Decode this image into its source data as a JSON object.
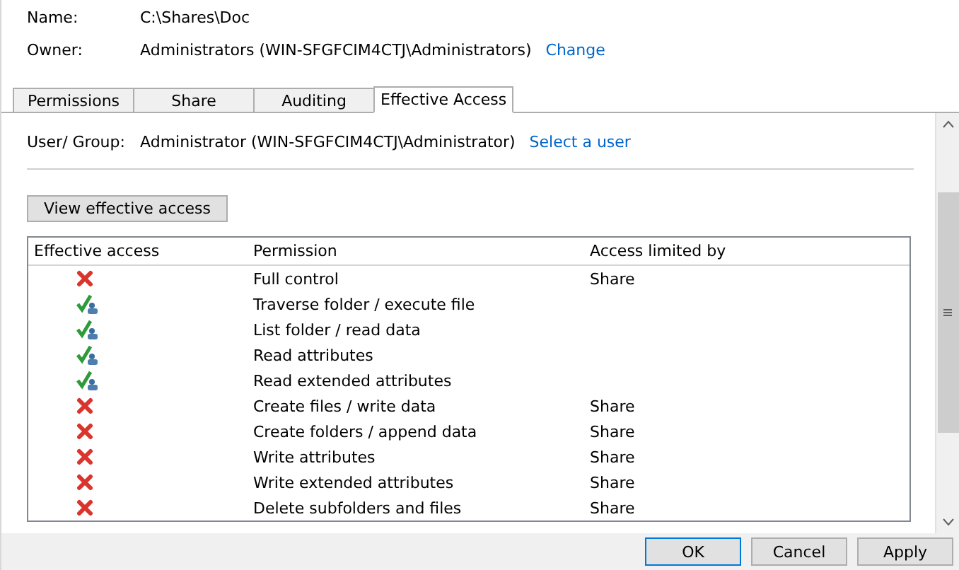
{
  "header": {
    "name_label": "Name:",
    "name_value": "C:\\Shares\\Doc",
    "owner_label": "Owner:",
    "owner_value": "Administrators (WIN-SFGFCIM4CTJ\\Administrators)",
    "owner_link": "Change"
  },
  "tabs": [
    {
      "label": "Permissions",
      "selected": false
    },
    {
      "label": "Share",
      "selected": false
    },
    {
      "label": "Auditing",
      "selected": false
    },
    {
      "label": "Effective Access",
      "selected": true
    }
  ],
  "user_group": {
    "label": "User/ Group:",
    "value": "Administrator (WIN-SFGFCIM4CTJ\\Administrator)",
    "link": "Select a user"
  },
  "view_button": "View effective access",
  "table": {
    "columns": [
      "Effective access",
      "Permission",
      "Access limited by"
    ],
    "rows": [
      {
        "allowed": false,
        "permission": "Full control",
        "limited_by": "Share"
      },
      {
        "allowed": true,
        "permission": "Traverse folder / execute file"
      },
      {
        "allowed": true,
        "permission": "List folder / read data"
      },
      {
        "allowed": true,
        "permission": "Read attributes"
      },
      {
        "allowed": true,
        "permission": "Read extended attributes"
      },
      {
        "allowed": false,
        "permission": "Create files / write data",
        "limited_by": "Share"
      },
      {
        "allowed": false,
        "permission": "Create folders / append data",
        "limited_by": "Share"
      },
      {
        "allowed": false,
        "permission": "Write attributes",
        "limited_by": "Share"
      },
      {
        "allowed": false,
        "permission": "Write extended attributes",
        "limited_by": "Share"
      },
      {
        "allowed": false,
        "permission": "Delete subfolders and files",
        "limited_by": "Share"
      }
    ]
  },
  "buttons": [
    "OK",
    "Cancel",
    "Apply"
  ]
}
